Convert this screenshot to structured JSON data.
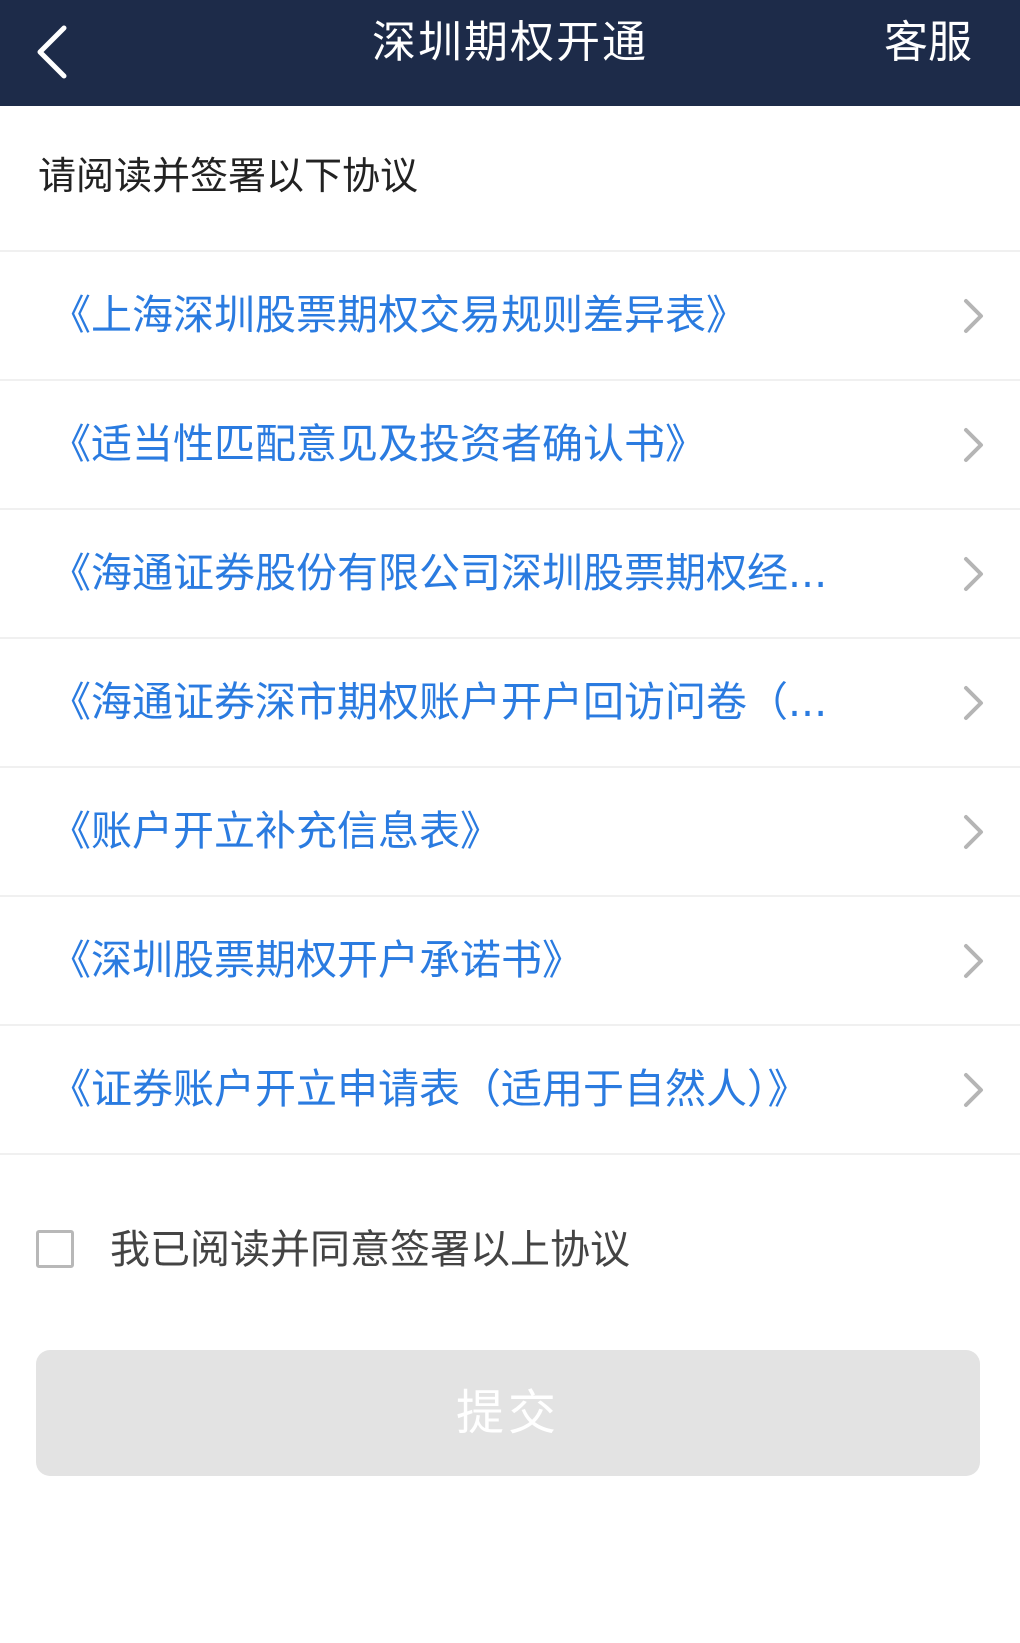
{
  "navbar": {
    "title": "深圳期权开通",
    "service_label": "客服",
    "back_icon": "chevron-left-icon",
    "background_color": "#1d2b49"
  },
  "intro": "请阅读并签署以下协议",
  "agreements": [
    {
      "label": "《上海深圳股票期权交易规则差异表》"
    },
    {
      "label": "《适当性匹配意见及投资者确认书》"
    },
    {
      "label": "《海通证券股份有限公司深圳股票期权经..."
    },
    {
      "label": "《海通证券深市期权账户开户回访问卷（..."
    },
    {
      "label": "《账户开立补充信息表》"
    },
    {
      "label": "《深圳股票期权开户承诺书》"
    },
    {
      "label": "《证券账户开立申请表（适用于自然人）》"
    }
  ],
  "agree": {
    "checked": false,
    "label": "我已阅读并同意签署以上协议"
  },
  "submit": {
    "label": "提交",
    "enabled": false
  },
  "colors": {
    "link": "#2a7be0",
    "disabled_button": "#e3e3e3"
  }
}
